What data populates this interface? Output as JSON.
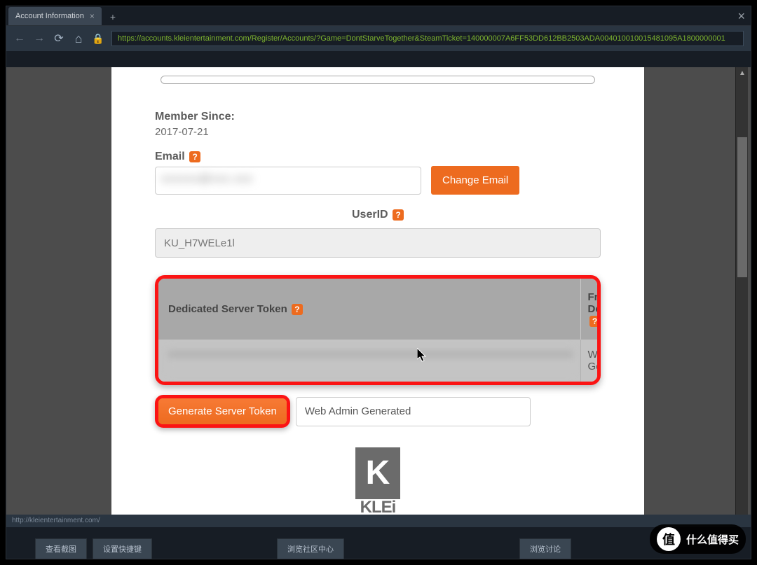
{
  "window": {
    "tab_title": "Account Information",
    "url": "https://accounts.kleientertainment.com/Register/Accounts/?Game=DontStarveTogether&SteamTicket=140000007A6FF53DD612BB2503ADA004010010015481095A1800000001"
  },
  "page": {
    "member_since_label": "Member Since:",
    "member_since_value": "2017-07-21",
    "email_label": "Email",
    "email_value_blurred": "xxxxxx@xxx.xxx",
    "change_email_btn": "Change Email",
    "userid_label": "UserID",
    "userid_value": "KU_H7WELe1l",
    "table": {
      "col1": "Dedicated Server Token",
      "col2": "Friendly Description",
      "row_token_blurred": "xxxxxxxxxxxxxxxxxxxxxxxxxxxxxxxxxxxxxxxxxxxxxxxxxxxxxxxxxxxxxxxxxxxxxxxxxxxxx",
      "row_desc": "Web Admin Generated"
    },
    "generate_btn": "Generate Server Token",
    "generate_input": "Web Admin Generated",
    "logo_text": "KLEi"
  },
  "status_bar": "http://kleientertainment.com/",
  "bottom_buttons": {
    "b1": "查看截图",
    "b2": "设置快捷键",
    "b3": "浏览社区中心",
    "b4": "浏览讨论"
  },
  "badge": "什么值得买",
  "badge_sym": "值",
  "help": "?"
}
